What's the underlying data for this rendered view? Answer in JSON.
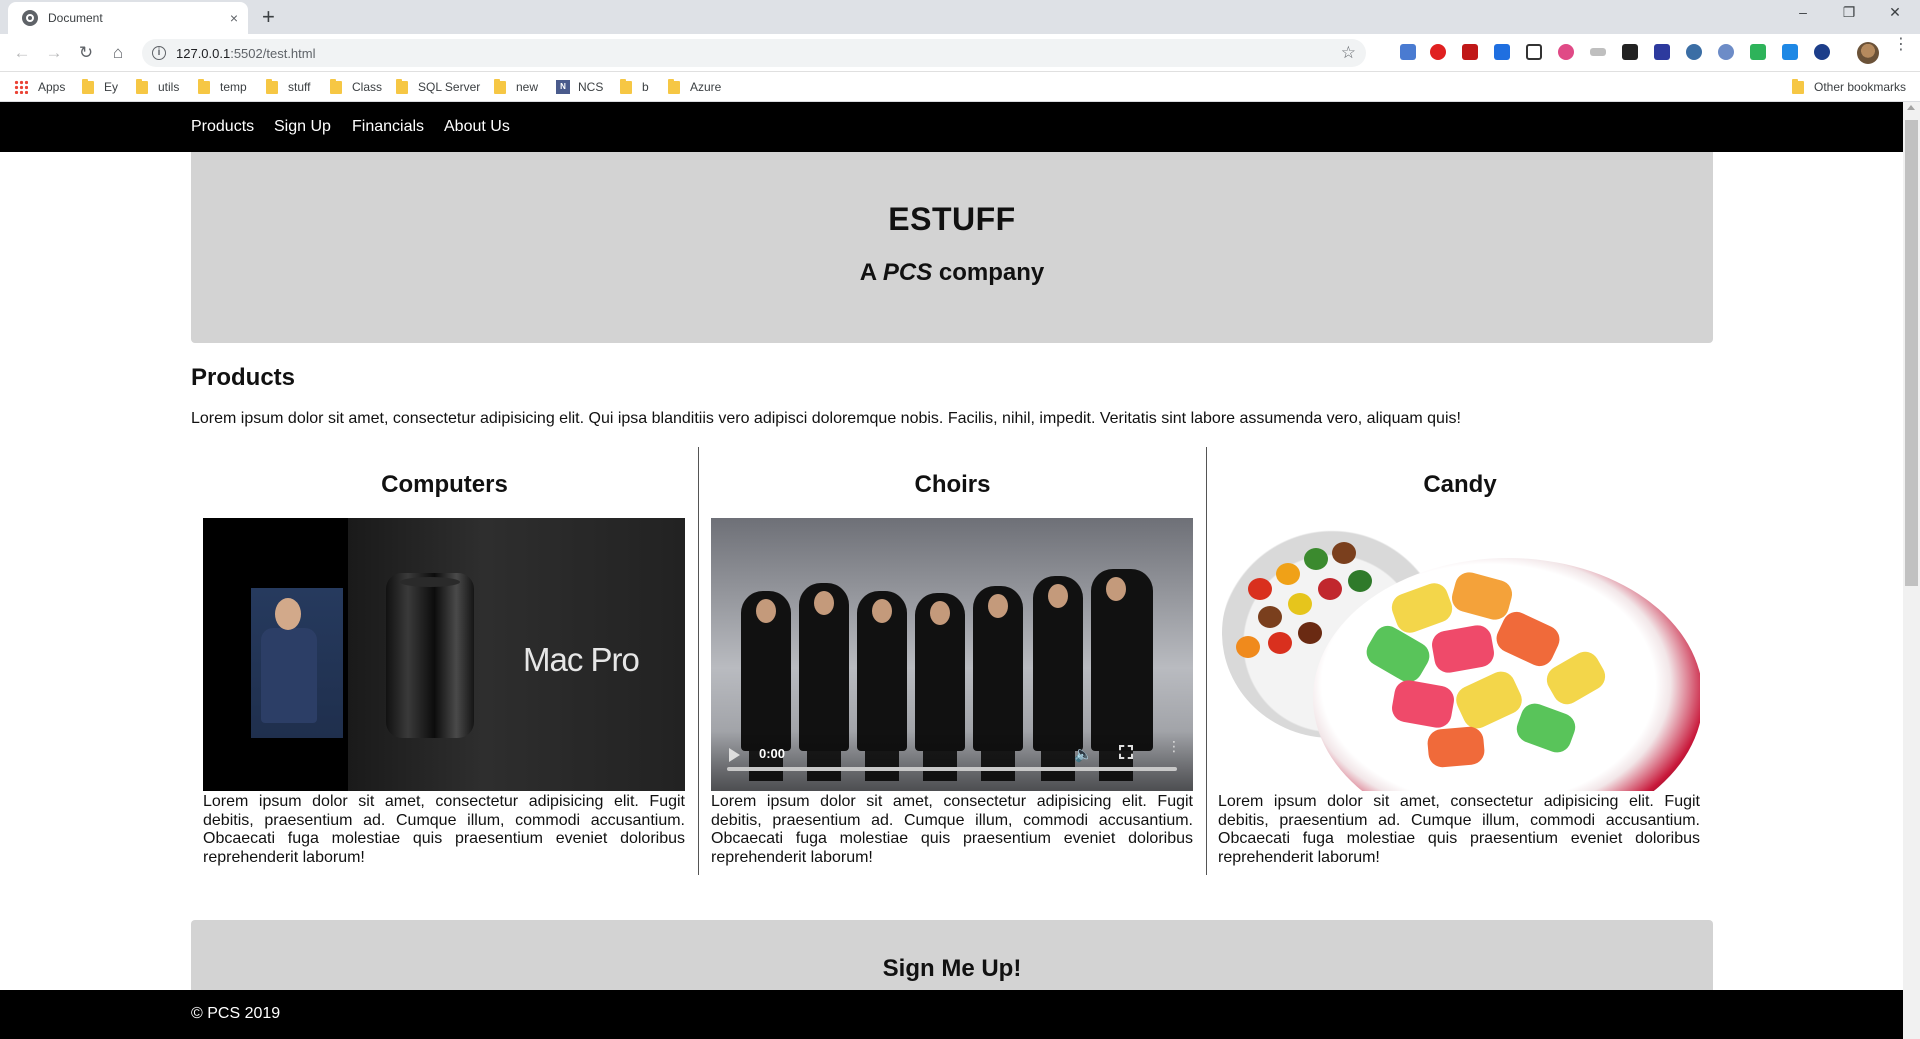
{
  "browser": {
    "tab_title": "Document",
    "tab_close": "×",
    "new_tab": "+",
    "window_controls": {
      "minimize": "–",
      "restore": "❐",
      "close": "✕"
    },
    "url_host": "127.0.0.1",
    "url_rest": ":5502/test.html",
    "bookmarks": [
      {
        "label": "Apps",
        "icon": "apps-grid-icon"
      },
      {
        "label": "Ey",
        "icon": "folder-icon"
      },
      {
        "label": "utils",
        "icon": "folder-icon"
      },
      {
        "label": "temp",
        "icon": "folder-icon"
      },
      {
        "label": "stuff",
        "icon": "folder-icon"
      },
      {
        "label": "Class",
        "icon": "folder-icon"
      },
      {
        "label": "SQL Server",
        "icon": "folder-icon"
      },
      {
        "label": "new",
        "icon": "folder-icon"
      },
      {
        "label": "NCS",
        "icon": "ncs-icon"
      },
      {
        "label": "b",
        "icon": "folder-icon"
      },
      {
        "label": "Azure",
        "icon": "folder-icon"
      }
    ],
    "other_bookmarks": "Other bookmarks"
  },
  "site": {
    "nav": [
      "Products",
      "Sign Up",
      "Financials",
      "About Us"
    ],
    "hero": {
      "title": "ESTUFF",
      "subtitle_prefix": "A ",
      "subtitle_em": "PCS",
      "subtitle_suffix": " company"
    },
    "products": {
      "title": "Products",
      "description": "Lorem ipsum dolor sit amet, consectetur adipisicing elit. Qui ipsa blanditiis vero adipisci doloremque nobis. Facilis, nihil, impedit. Veritatis sint labore assumenda vero, aliquam quis!",
      "items": [
        {
          "title": "Computers",
          "media_label": "Mac Pro",
          "text": "Lorem ipsum dolor sit amet, consectetur adipisicing elit. Fugit debitis, praesentium ad. Cumque illum, commodi accusantium. Obcaecati fuga molestiae quis praesentium eveniet doloribus reprehenderit laborum!"
        },
        {
          "title": "Choirs",
          "video_time": "0:00",
          "text": "Lorem ipsum dolor sit amet, consectetur adipisicing elit. Fugit debitis, praesentium ad. Cumque illum, commodi accusantium. Obcaecati fuga molestiae quis praesentium eveniet doloribus reprehenderit laborum!"
        },
        {
          "title": "Candy",
          "text": "Lorem ipsum dolor sit amet, consectetur adipisicing elit. Fugit debitis, praesentium ad. Cumque illum, commodi accusantium. Obcaecati fuga molestiae quis praesentium eveniet doloribus reprehenderit laborum!"
        }
      ]
    },
    "signup": {
      "title": "Sign Me Up!"
    },
    "footer": "© PCS 2019"
  },
  "colors": {
    "nav_bg": "#000000",
    "panel_bg": "#d3d3d3",
    "text": "#111111"
  }
}
